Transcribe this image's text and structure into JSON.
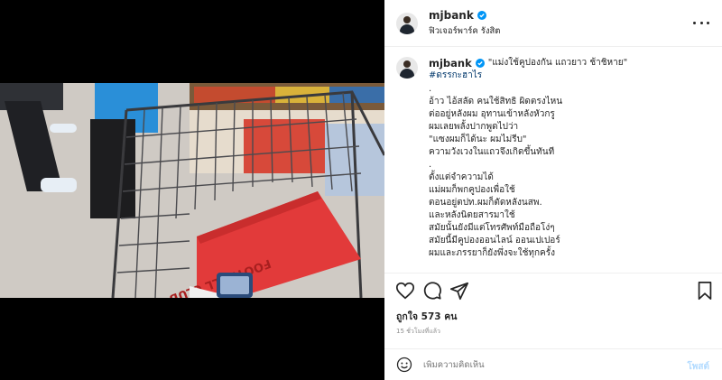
{
  "post": {
    "username": "mjbank",
    "location": "ฟิวเจอร์พาร์ค รังสิต",
    "caption_title": "\"แม่งใช้คูปองกัน แถวยาว ช้าชิหาย\"",
    "hashtag": "#ดรรกะฮาไร",
    "caption_lines": [
      ".",
      "อ้าว ไอ้สลัด คนใช้สิทธิ ผิดตรงไหน",
      "ต่ออยู่หลังผม อุทานเข้าหลังหัวกรู",
      "ผมเลยพลั้งปากพูดไปว่า",
      "\"แซงผมก็ได้นะ ผมไม่รีบ\"",
      "ความวังเวงในแถวจึงเกิดขึ้นทันที",
      ".",
      "ตั้งแต่จำความได้",
      "แม่ผมก็พกคูปองเพื่อใช้",
      "ตอนอยู่ตปท.ผมก็ตัดหลังนสพ.",
      "และหลังนิตยสารมาใช้",
      "สมัยนั้นยังมีแต่โทรศัพท์มือถือโง่ๆ",
      "สมัยนี้มีคูปองออนไลน์ ออนเปเปอร์",
      "ผมและภรรยาก็ยังพึ่งจะใช้ทุกครั้ง"
    ],
    "likes_text": "ถูกใจ 573 คน",
    "time_text": "15 ชั่วโมงที่แล้ว",
    "comment_placeholder": "เพิ่มความคิดเห็น",
    "post_button": "โพสต์"
  },
  "photo": {
    "description_icons": [
      "shopping-cart",
      "red-book"
    ],
    "book_cover_text": "FOOTBALL CLUB"
  },
  "colors": {
    "verified": "#0095f6",
    "hashtag": "#00376b",
    "post_button_disabled": "#b3dbff",
    "book_red": "#e23a3a"
  },
  "icons": {
    "more": "more-dots-icon",
    "like": "heart-icon",
    "comment": "comment-icon",
    "share": "share-icon",
    "save": "bookmark-icon",
    "emoji": "emoji-icon"
  }
}
